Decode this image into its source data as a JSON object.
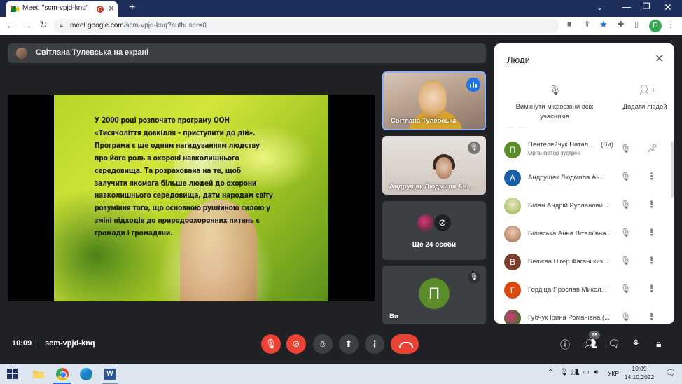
{
  "browser": {
    "tab_title": "Meet: \"scm-vpjd-knq\"",
    "tab_close": "✕",
    "new_tab": "+",
    "tabs_menu": "⌄",
    "window_min": "—",
    "window_max": "❐",
    "window_close": "✕",
    "url_host": "meet.google.com",
    "url_path": "/scm-vpjd-knq?authuser=0",
    "profile_initial": "П"
  },
  "meet": {
    "presenter_banner": "Світлана Тулевська на екрані",
    "slide_lines": [
      "У 2000 році розпочато програму ООН",
      "«Тисячоліття довкілля – приступити до дій».",
      "Програма є ще одним нагадуванням людству",
      "про його роль в охороні навколишнього",
      "середовища. Та розрахована на те, щоб",
      "залучити якомога більше людей до охорони",
      "навколишнього середовища, дати народам світу",
      "розуміння того, що основною рушійною силою у",
      "зміні підходів до природоохоронних питань є",
      "громади і громадяни."
    ],
    "tiles": {
      "tile1_name": "Світлана Тулевська",
      "tile2_name": "Андрущак Людмила Ан...",
      "more_label": "Ще 24 особи",
      "self_initial": "П",
      "self_label": "Ви"
    }
  },
  "people_panel": {
    "title": "Люди",
    "mute_all_label": "Вимкнути мікрофони всіх учасників",
    "add_people_label": "Додати людей",
    "participants": [
      {
        "initial": "П",
        "name": "Пентелейчук Натал...",
        "you": "(Ви)",
        "role": "Організатор зустрічі",
        "color": "#5b8c2a"
      },
      {
        "initial": "А",
        "name": "Андрущак Людмила Ан...",
        "color": "#1a5fa8"
      },
      {
        "initial": "",
        "name": "Білан Андрій Русланови...",
        "color": "#c9b08a"
      },
      {
        "initial": "",
        "name": "Білівська Анна Віталіївна...",
        "color": "#b5866a"
      },
      {
        "initial": "В",
        "name": "Велієва Нігер Фагані киз...",
        "color": "#7a3e2c"
      },
      {
        "initial": "Г",
        "name": "Гордіца Ярослав Микол...",
        "color": "#d9480f"
      },
      {
        "initial": "",
        "name": "Губчук Ірина Романівна (...",
        "color": "#9c2f5f"
      }
    ]
  },
  "controls": {
    "clock": "10:09",
    "separator": "|",
    "meeting_code": "scm-vpjd-knq",
    "people_count": "28"
  },
  "taskbar": {
    "word_letter": "W",
    "language": "УКР",
    "time": "10:09",
    "date": "14.10.2022"
  }
}
